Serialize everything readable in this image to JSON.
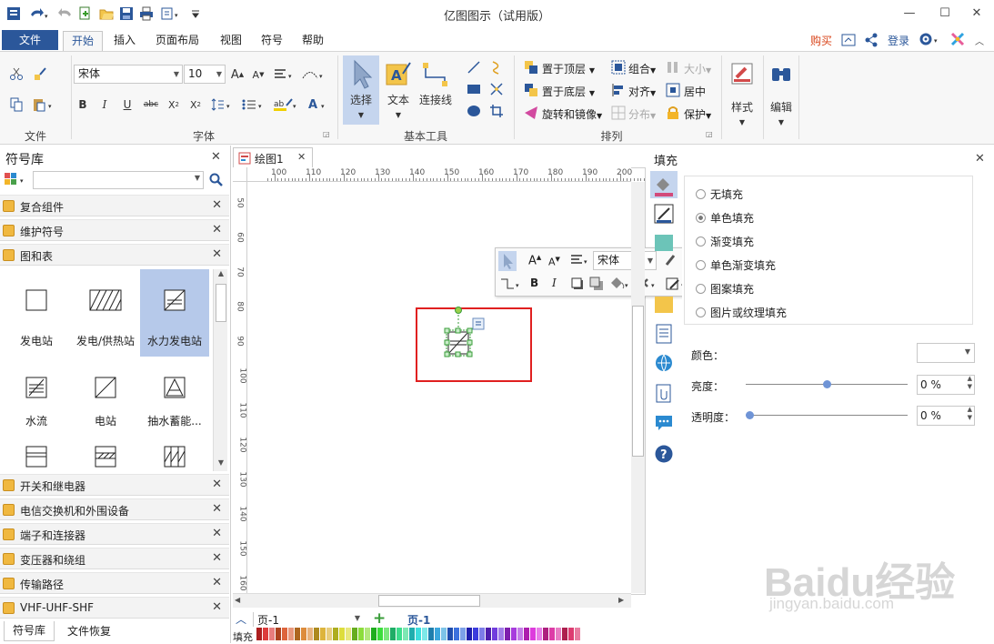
{
  "window": {
    "title": "亿图图示（试用版）",
    "min": "—",
    "max": "☐",
    "close": "✕"
  },
  "menu": {
    "tabs": [
      "文件",
      "开始",
      "插入",
      "页面布局",
      "视图",
      "符号",
      "帮助"
    ],
    "right_links": {
      "buy": "购买",
      "login": "登录"
    }
  },
  "ribbon": {
    "groups": {
      "file": "文件",
      "font": "字体",
      "basic_tools": "基本工具",
      "arrange": "排列"
    },
    "font_name": "宋体",
    "font_size": "10",
    "tools": {
      "select": "选择",
      "text": "文本",
      "connector": "连接线"
    },
    "arrange": {
      "bring_front": "置于顶层",
      "send_back": "置于底层",
      "rotate_mirror": "旋转和镜像",
      "group": "组合",
      "align": "对齐",
      "distribute": "分布",
      "size": "大小",
      "center": "居中",
      "protect": "保护"
    },
    "style": "样式",
    "edit": "编辑"
  },
  "symbol_library": {
    "title": "符号库",
    "top_categories": [
      "复合组件",
      "维护符号",
      "图和表"
    ],
    "symbols": [
      "发电站",
      "发电/供热站",
      "水力发电站",
      "水流",
      "电站",
      "抽水蓄能..."
    ],
    "bottom_categories": [
      "开关和继电器",
      "电信交换机和外围设备",
      "端子和连接器",
      "变压器和绕组",
      "传输路径",
      "VHF-UHF-SHF"
    ],
    "bottom_tabs": [
      "符号库",
      "文件恢复"
    ]
  },
  "document": {
    "tab": "绘图1",
    "hruler_ticks": [
      "100",
      "110",
      "120",
      "130",
      "140",
      "150",
      "160",
      "170",
      "180",
      "190",
      "200"
    ],
    "vruler_ticks": [
      "50",
      "60",
      "70",
      "80",
      "90",
      "100",
      "110",
      "120",
      "130",
      "140",
      "150",
      "160"
    ]
  },
  "floating_toolbar": {
    "font": "宋体"
  },
  "fill_panel": {
    "title": "填充",
    "options": [
      "无填充",
      "单色填充",
      "渐变填充",
      "单色渐变填充",
      "图案填充",
      "图片或纹理填充"
    ],
    "selected_option": "单色填充",
    "color_label": "颜色：",
    "brightness_label": "亮度：",
    "brightness_value": "0 %",
    "transparency_label": "透明度：",
    "transparency_value": "0 %",
    "brightness_level": 0.5,
    "transparency_level": 0
  },
  "page_bar": {
    "page_select": "页-1",
    "active_page": "页-1"
  },
  "status": {
    "fill_label": "填充"
  },
  "watermark": {
    "text": "Baidu经验",
    "url": "jingyan.baidu.com"
  },
  "colors": {
    "accent": "#2b579a",
    "highlight": "#e02020",
    "selected_symbol": "#b6c9ea"
  }
}
